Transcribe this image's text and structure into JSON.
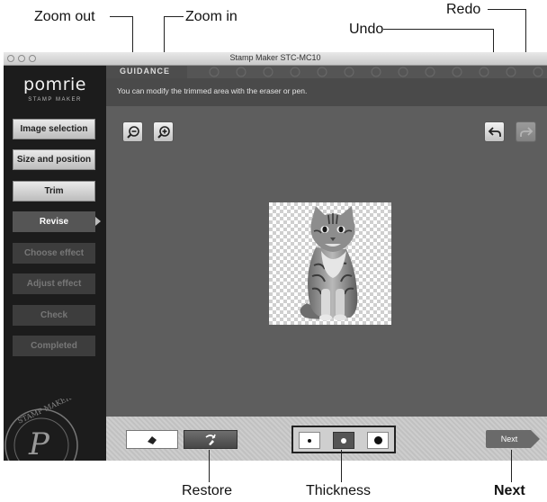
{
  "callouts": {
    "zoom_out": "Zoom out",
    "zoom_in": "Zoom in",
    "undo": "Undo",
    "redo": "Redo",
    "restore": "Restore",
    "thickness": "Thickness",
    "next": "Next"
  },
  "window": {
    "title": "Stamp Maker STC-MC10"
  },
  "logo": {
    "name": "pomrie",
    "subtitle": "STAMP MAKER"
  },
  "steps": [
    {
      "label": "Image selection",
      "state": "done"
    },
    {
      "label": "Size and position",
      "state": "done"
    },
    {
      "label": "Trim",
      "state": "done"
    },
    {
      "label": "Revise",
      "state": "current"
    },
    {
      "label": "Choose effect",
      "state": "future"
    },
    {
      "label": "Adjust effect",
      "state": "future"
    },
    {
      "label": "Check",
      "state": "future"
    },
    {
      "label": "Completed",
      "state": "future"
    }
  ],
  "guidance": {
    "title": "GUIDANCE",
    "text": "You can modify the trimmed area with the eraser or pen."
  },
  "toolbar": {
    "zoom_out_icon": "zoom-out-icon",
    "zoom_in_icon": "zoom-in-icon",
    "undo_icon": "undo-icon",
    "redo_icon": "redo-icon",
    "redo_enabled": false
  },
  "bottom": {
    "eraser_icon": "eraser-icon",
    "restore_icon": "restore-icon",
    "thickness_options": [
      "small",
      "medium",
      "large"
    ],
    "thickness_selected": "medium",
    "next_label": "Next"
  },
  "colors": {
    "accent": "#555555",
    "window_bg": "#5d5d5d",
    "sidebar_bg": "#1c1c1c"
  }
}
